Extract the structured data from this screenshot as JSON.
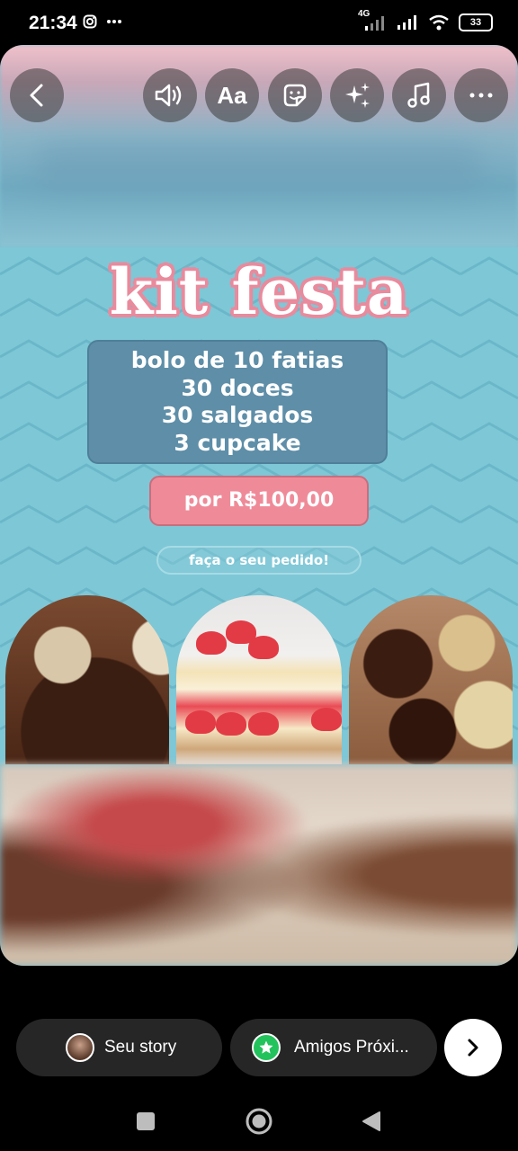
{
  "status_bar": {
    "time": "21:34",
    "network": "4G",
    "battery": "33"
  },
  "toolbar": {
    "back_icon": "chevron-left-icon",
    "sound_icon": "speaker-icon",
    "text_label": "Aa",
    "sticker_icon": "sticker-icon",
    "effects_icon": "sparkles-icon",
    "music_icon": "music-note-icon",
    "more_icon": "more-horizontal-icon"
  },
  "flyer": {
    "title": "kit festa",
    "items": [
      "bolo de 10 fatias",
      "30 doces",
      "30 salgados",
      "3 cupcake"
    ],
    "price": "por R$100,00",
    "cta": "faça o seu pedido!",
    "colors": {
      "background": "#7ec7d6",
      "box": "#5e8ea8",
      "price_pill": "#ef8b99",
      "title_outline": "#e98a9d"
    }
  },
  "share_bar": {
    "your_story_label": "Seu story",
    "close_friends_label": "Amigos Próxi...",
    "next_icon": "chevron-right-icon",
    "close_friends_color": "#22c25c"
  },
  "nav_bar": {
    "recents_icon": "square-icon",
    "home_icon": "circle-icon",
    "back_icon": "triangle-back-icon"
  }
}
